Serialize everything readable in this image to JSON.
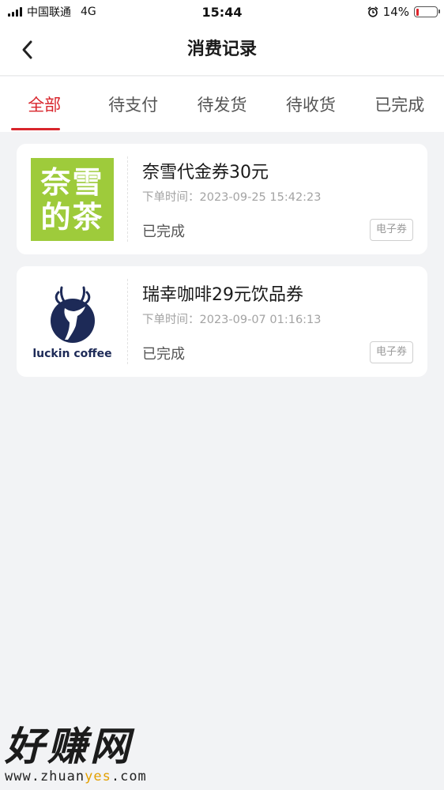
{
  "status_bar": {
    "carrier": "中国联通",
    "network": "4G",
    "time": "15:44",
    "battery_level": "14%",
    "battery_fraction": 0.14,
    "battery_color": "#e0242b",
    "icons": [
      "signal-icon",
      "alarm-icon",
      "battery-icon"
    ]
  },
  "header": {
    "title": "消费记录",
    "back_icon": "chevron-left-icon"
  },
  "tabs": [
    {
      "label": "全部",
      "active": true
    },
    {
      "label": "待支付",
      "active": false
    },
    {
      "label": "待发货",
      "active": false
    },
    {
      "label": "待收货",
      "active": false
    },
    {
      "label": "已完成",
      "active": false
    }
  ],
  "accent_color": "#d8252c",
  "orders": [
    {
      "logo_text_line1": "奈雪",
      "logo_text_line2": "的茶",
      "logo_color": "#9ecb3b",
      "title": "奈雪代金券30元",
      "time_label": "下单时间：",
      "time_value": "2023-09-25 15:42:23",
      "status": "已完成",
      "badge": "电子券"
    },
    {
      "logo_text": "luckin coffee",
      "logo_color": "#1d2a57",
      "title": "瑞幸咖啡29元饮品券",
      "time_label": "下单时间：",
      "time_value": "2023-09-07 01:16:13",
      "status": "已完成",
      "badge": "电子券"
    }
  ],
  "watermark": {
    "text": "好赚网",
    "url_pre": "www.zhuan",
    "url_accent": "yes",
    "url_post": ".com"
  }
}
